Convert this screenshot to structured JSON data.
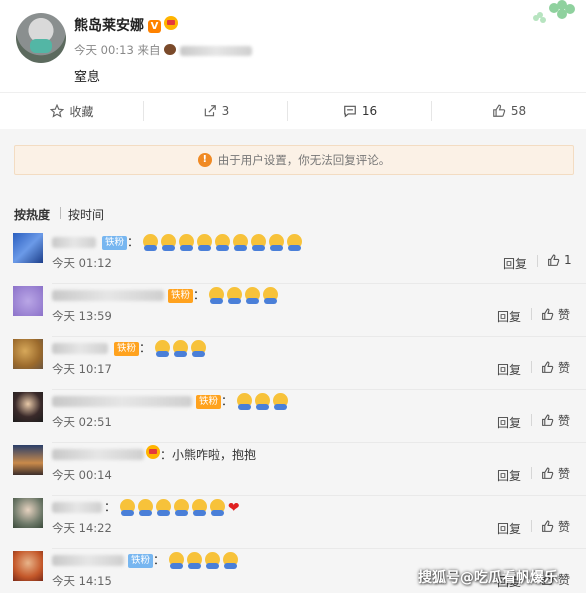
{
  "post": {
    "author": "熊岛莱安娜",
    "v_badge": "V",
    "time": "今天 00:13",
    "source_prefix": "来自",
    "text": "窒息"
  },
  "actions": [
    {
      "label": "收藏",
      "icon": "star-icon"
    },
    {
      "label": "3",
      "icon": "share-icon"
    },
    {
      "label": "16",
      "icon": "comment-icon"
    },
    {
      "label": "58",
      "icon": "like-icon"
    }
  ],
  "notice": "由于用户设置，你无法回复评论。",
  "sort": {
    "hot": "按热度",
    "time": "按时间"
  },
  "comments": [
    {
      "time": "今天 01:12",
      "reply": "回复",
      "like": "1",
      "badge": "铁粉",
      "suffix": "："
    },
    {
      "time": "今天 13:59",
      "reply": "回复",
      "like": "赞",
      "badge": "铁粉",
      "suffix": "："
    },
    {
      "time": "今天 10:17",
      "reply": "回复",
      "like": "赞",
      "badge": "铁粉",
      "suffix": "："
    },
    {
      "time": "今天 02:51",
      "reply": "回复",
      "like": "赞",
      "badge": "铁粉",
      "suffix": "："
    },
    {
      "time": "今天 00:14",
      "reply": "回复",
      "like": "赞",
      "badge": "",
      "text": "：小熊咋啦，抱抱"
    },
    {
      "time": "今天 14:22",
      "reply": "回复",
      "like": "赞",
      "badge": "",
      "suffix": "："
    },
    {
      "time": "今天 14:15",
      "reply": "回复",
      "like": "赞",
      "badge": "铁粉",
      "suffix": "："
    }
  ],
  "watermark": "搜狐号@吃瓜看帆爆乐",
  "colors": {
    "accent": "#ff8200",
    "notice_bg": "#fbf1e6",
    "fan_badge": "#ffa21e",
    "fan_badge_blue": "#77b6f0"
  }
}
